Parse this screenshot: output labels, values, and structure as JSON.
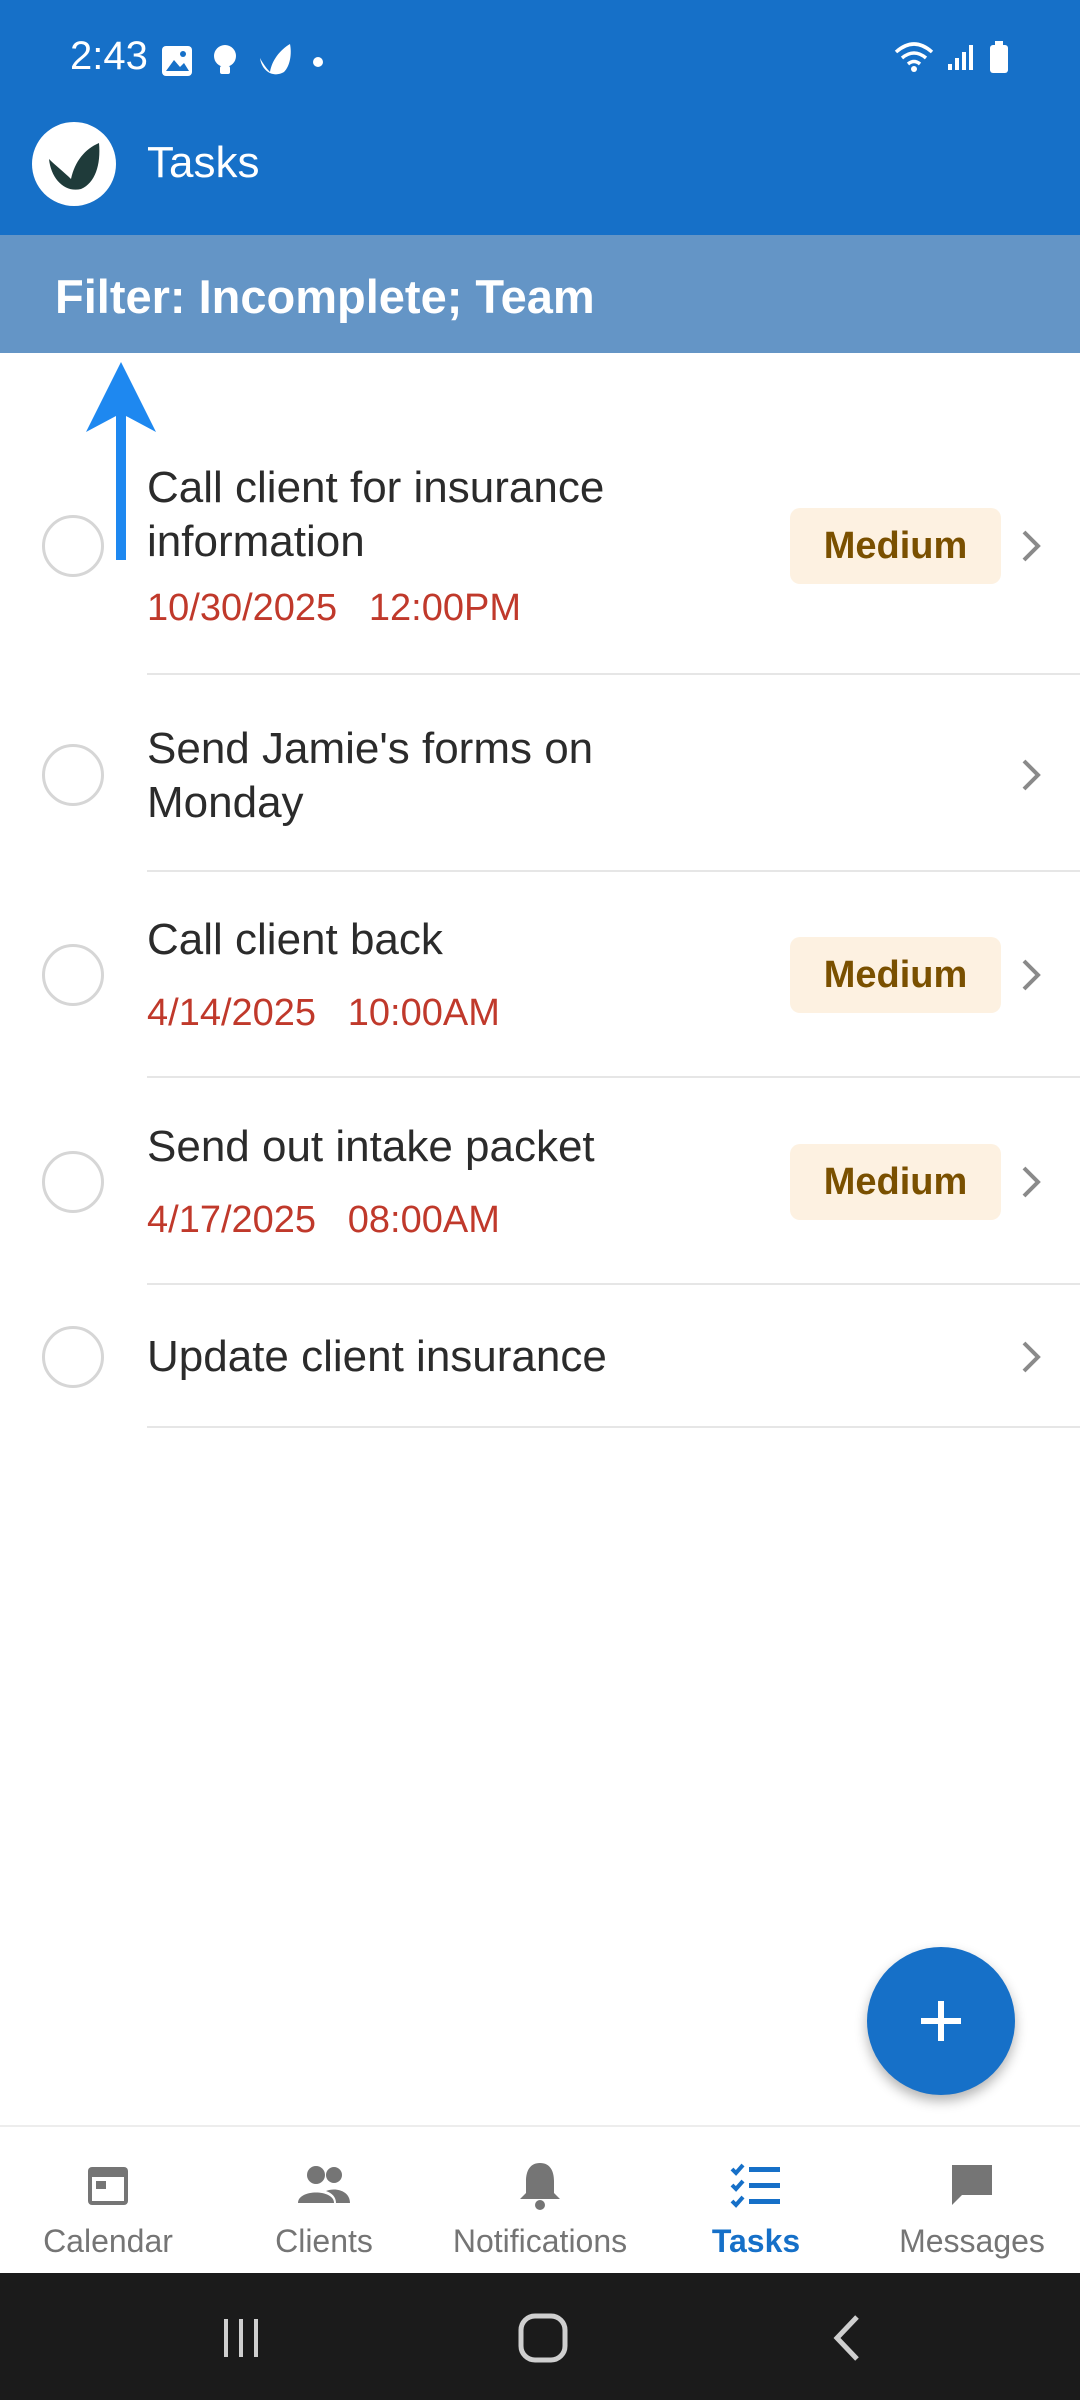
{
  "status_bar": {
    "time": "2:43",
    "left_icons": [
      "image-icon",
      "lightbulb-icon",
      "app-leaf-icon",
      "dot-icon"
    ],
    "right_icons": [
      "wifi-icon",
      "signal-icon",
      "battery-icon"
    ]
  },
  "app_bar": {
    "title": "Tasks",
    "logo": "app-logo"
  },
  "filter": {
    "text": "Filter: Incomplete; Team"
  },
  "tasks": [
    {
      "title": "Call client for insurance information",
      "date": "10/30/2025",
      "time": "12:00PM",
      "priority": "Medium"
    },
    {
      "title": "Send Jamie's forms on Monday"
    },
    {
      "title": "Call client back",
      "date": "4/14/2025",
      "time": "10:00AM",
      "priority": "Medium"
    },
    {
      "title": "Send out intake packet",
      "date": "4/17/2025",
      "time": "08:00AM",
      "priority": "Medium"
    },
    {
      "title": "Update client insurance"
    }
  ],
  "fab": {
    "icon": "plus-icon"
  },
  "bottom_nav": {
    "items": [
      {
        "label": "Calendar",
        "icon": "calendar-icon"
      },
      {
        "label": "Clients",
        "icon": "people-icon"
      },
      {
        "label": "Notifications",
        "icon": "bell-icon"
      },
      {
        "label": "Tasks",
        "icon": "checklist-icon",
        "active": true
      },
      {
        "label": "Messages",
        "icon": "chat-icon"
      }
    ]
  },
  "system_nav": [
    "recents-icon",
    "home-icon",
    "back-icon"
  ],
  "colors": {
    "primary": "#1670c8",
    "filter_banner": "#6495c6",
    "due_date": "#c0392b",
    "priority_bg": "#fdf1e1",
    "priority_text": "#7a5000",
    "annotation_arrow": "#1e88f0"
  }
}
